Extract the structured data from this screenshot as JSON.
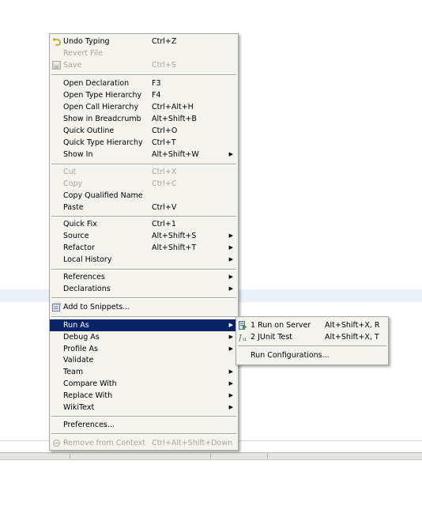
{
  "context_menu": {
    "undo_typing": {
      "label": "Undo Typing",
      "accel": "Ctrl+Z"
    },
    "revert_file": {
      "label": "Revert File"
    },
    "save": {
      "label": "Save",
      "accel": "Ctrl+S"
    },
    "open_declaration": {
      "label": "Open Declaration",
      "accel": "F3"
    },
    "open_type_hierarchy": {
      "label": "Open Type Hierarchy",
      "accel": "F4"
    },
    "open_call_hierarchy": {
      "label": "Open Call Hierarchy",
      "accel": "Ctrl+Alt+H"
    },
    "show_in_breadcrumb": {
      "label": "Show in Breadcrumb",
      "accel": "Alt+Shift+B"
    },
    "quick_outline": {
      "label": "Quick Outline",
      "accel": "Ctrl+O"
    },
    "quick_type_hierarchy": {
      "label": "Quick Type Hierarchy",
      "accel": "Ctrl+T"
    },
    "show_in": {
      "label": "Show In",
      "accel": "Alt+Shift+W"
    },
    "cut": {
      "label": "Cut",
      "accel": "Ctrl+X"
    },
    "copy": {
      "label": "Copy",
      "accel": "Ctrl+C"
    },
    "copy_qualified_name": {
      "label": "Copy Qualified Name"
    },
    "paste": {
      "label": "Paste",
      "accel": "Ctrl+V"
    },
    "quick_fix": {
      "label": "Quick Fix",
      "accel": "Ctrl+1"
    },
    "source": {
      "label": "Source",
      "accel": "Alt+Shift+S"
    },
    "refactor": {
      "label": "Refactor",
      "accel": "Alt+Shift+T"
    },
    "local_history": {
      "label": "Local History"
    },
    "references": {
      "label": "References"
    },
    "declarations": {
      "label": "Declarations"
    },
    "add_to_snippets": {
      "label": "Add to Snippets..."
    },
    "run_as": {
      "label": "Run As"
    },
    "debug_as": {
      "label": "Debug As"
    },
    "profile_as": {
      "label": "Profile As"
    },
    "validate": {
      "label": "Validate"
    },
    "team": {
      "label": "Team"
    },
    "compare_with": {
      "label": "Compare With"
    },
    "replace_with": {
      "label": "Replace With"
    },
    "wikitext": {
      "label": "WikiText"
    },
    "preferences": {
      "label": "Preferences..."
    },
    "remove_from_context": {
      "label": "Remove from Context",
      "accel": "Ctrl+Alt+Shift+Down"
    },
    "submenu_arrow": "▶"
  },
  "run_as_submenu": {
    "run_on_server": {
      "label": "1 Run on Server",
      "accel": "Alt+Shift+X, R"
    },
    "junit_test": {
      "label": "2 JUnit Test",
      "accel": "Alt+Shift+X, T"
    },
    "run_configurations": {
      "label": "Run Configurations..."
    }
  },
  "icons": [
    "undo-icon",
    "save-icon",
    "snippets-icon",
    "run-on-server-icon",
    "junit-icon"
  ],
  "colors": {
    "menu_bg": "#f4f3ee",
    "selection_bg": "#0a246a",
    "disabled_text": "#a7a69d",
    "border": "#a9a89f"
  }
}
